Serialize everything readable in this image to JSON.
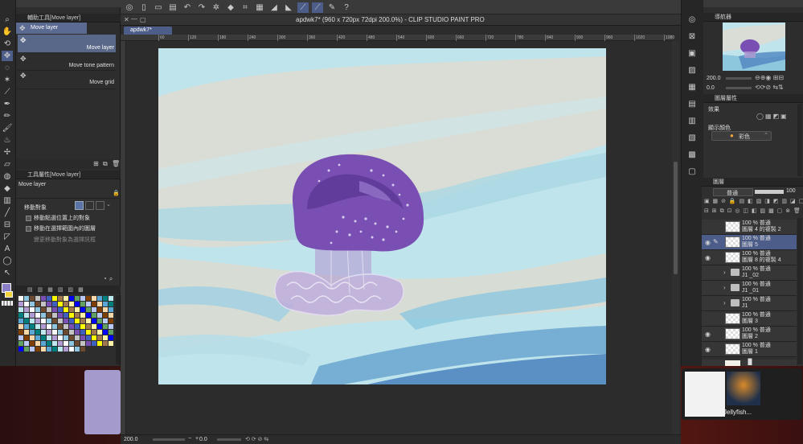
{
  "window": {
    "title": "apdwk7* (960 x 720px 72dpi 200.0%) - CLIP STUDIO PAINT PRO",
    "tab": "apdwk7*"
  },
  "sub_tool_panel": {
    "title": "輔助工具[Move layer]",
    "active_tab": "Move layer",
    "items": [
      {
        "label": "Move layer"
      },
      {
        "label": "Move tone pattern"
      },
      {
        "label": "Move grid"
      }
    ]
  },
  "tool_property": {
    "title": "工具屬性[Move layer]",
    "name": "Move layer",
    "target_label": "移動對象",
    "options": [
      "移動點選位置上的對象",
      "移動在選擇範圍內的圖層",
      "變更移動對象為選擇訊框"
    ]
  },
  "ruler": {
    "ticks": [
      "60",
      "120",
      "180",
      "240",
      "300",
      "360",
      "420",
      "480",
      "540",
      "600",
      "660",
      "720",
      "780",
      "840",
      "900",
      "960",
      "1020",
      "1080"
    ]
  },
  "status": {
    "zoom": "200.0",
    "angle": "0.0"
  },
  "navigator": {
    "title": "導航器",
    "zoom": "200.0",
    "angle": "0.0"
  },
  "layer_property": {
    "title": "圖層屬性",
    "effect_label": "效果",
    "display_color_label": "顯示顏色",
    "color_mode": "彩色"
  },
  "layers_panel": {
    "title": "圖層",
    "blend_mode": "普通",
    "opacity": "100",
    "layers": [
      {
        "line1": "100 % 普通",
        "line2": "圖層 4 的複製 2",
        "type": "raster",
        "visible": false,
        "selected": false
      },
      {
        "line1": "100 % 普通",
        "line2": "圖層 5",
        "type": "raster",
        "visible": true,
        "selected": true
      },
      {
        "line1": "100 % 普通",
        "line2": "圖層 8 的複製 4",
        "type": "raster",
        "visible": true,
        "selected": false
      },
      {
        "line1": "100 % 普通",
        "line2": "J1 _02",
        "type": "folder",
        "visible": false,
        "selected": false
      },
      {
        "line1": "100 % 普通",
        "line2": "J1 _01",
        "type": "folder",
        "visible": false,
        "selected": false
      },
      {
        "line1": "100 % 普通",
        "line2": "J1",
        "type": "folder",
        "visible": false,
        "selected": false
      },
      {
        "line1": "100 % 普通",
        "line2": "圖層 3",
        "type": "raster",
        "visible": false,
        "selected": false
      },
      {
        "line1": "100 % 普通",
        "line2": "圖層 2",
        "type": "raster",
        "visible": true,
        "selected": false
      },
      {
        "line1": "100 % 普通",
        "line2": "圖層 1",
        "type": "raster",
        "visible": true,
        "selected": false
      }
    ]
  },
  "background_window": {
    "label": "Jellyfish..."
  },
  "colors": {
    "accent": "#4c5d8a",
    "panel": "#2f2f2f",
    "canvas_sky": "#bfe4ec",
    "jellyfish": "#7a4fb3"
  }
}
